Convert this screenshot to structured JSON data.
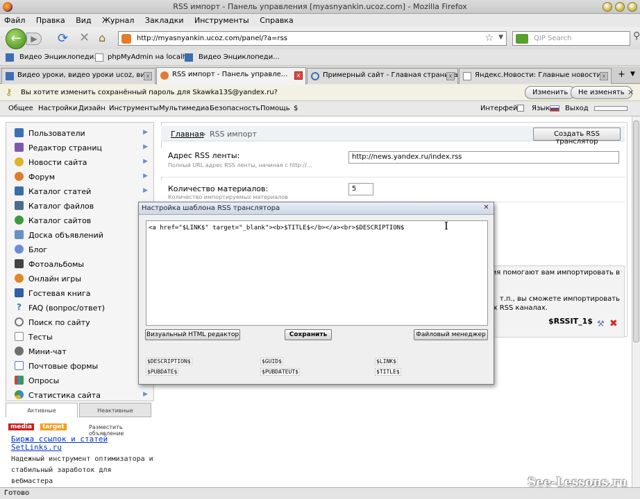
{
  "window": {
    "title": "RSS импорт - Панель управления [myasnyankin.ucoz.com] - Mozilla Firefox"
  },
  "menu": [
    "Файл",
    "Правка",
    "Вид",
    "Журнал",
    "Закладки",
    "Инструменты",
    "Справка"
  ],
  "nav": {
    "url": "http://myasnyankin.ucoz.com/panel/?a=rss",
    "search_placeholder": "QIP Search"
  },
  "bookmarks": [
    "Видео Энциклопеди...",
    "phpMyAdmin на localh...",
    "Видео Энциклопеди..."
  ],
  "tabs": [
    {
      "label": "Видео уроки, видео уроки ucoz, ви..."
    },
    {
      "label": "RSS импорт - Панель управле..."
    },
    {
      "label": "Примерный сайт - Главная страница"
    },
    {
      "label": "Яндекс.Новости: Главные новости"
    }
  ],
  "password_bar": {
    "message": "Вы хотите изменить сохранённый пароль для Skawka13S@yandex.ru?",
    "change": "Изменить",
    "dont_change": "Не изменять"
  },
  "app_toolbar": {
    "menu": [
      "Общее",
      "Настройки",
      "Дизайн",
      "Инструменты",
      "Мультимедиа",
      "Безопасность",
      "Помощь",
      "$"
    ],
    "interface": "Интерфейс",
    "language": "Язык",
    "logout": "Выход"
  },
  "sidebar": {
    "items": [
      {
        "label": "Пользователи",
        "arrow": true,
        "color": "#3b6fb6"
      },
      {
        "label": "Редактор страниц",
        "arrow": true,
        "color": "#7a5ba8"
      },
      {
        "label": "Новости сайта",
        "arrow": true,
        "color": "#e2b12a"
      },
      {
        "label": "Форум",
        "arrow": true,
        "color": "#e07b2a"
      },
      {
        "label": "Каталог статей",
        "arrow": true,
        "color": "#3a6ea5"
      },
      {
        "label": "Каталог файлов",
        "arrow": false,
        "color": "#4d6b8a"
      },
      {
        "label": "Каталог сайтов",
        "arrow": false,
        "color": "#3d9a3d"
      },
      {
        "label": "Доска объявлений",
        "arrow": false,
        "color": "#6b8fc4"
      },
      {
        "label": "Блог",
        "arrow": false,
        "color": "#6a8ed6"
      },
      {
        "label": "Фотоальбомы",
        "arrow": false,
        "color": "#444444"
      },
      {
        "label": "Онлайн игры",
        "arrow": false,
        "color": "#e0862a"
      },
      {
        "label": "Гостевая книга",
        "arrow": false,
        "color": "#2f5fa8"
      },
      {
        "label": "FAQ (вопрос/ответ)",
        "arrow": false,
        "color": "#3c6ec0"
      },
      {
        "label": "Поиск по сайту",
        "arrow": false,
        "color": "#777777"
      },
      {
        "label": "Тесты",
        "arrow": false,
        "color": "#8a8a8a"
      },
      {
        "label": "Мини-чат",
        "arrow": false,
        "color": "#6f6f6f"
      },
      {
        "label": "Почтовые формы",
        "arrow": false,
        "color": "#5a7bb0"
      },
      {
        "label": "Опросы",
        "arrow": false,
        "color": "#c44a2a"
      },
      {
        "label": "Статистика сайта",
        "arrow": true,
        "color": "#2f8fd0"
      }
    ],
    "tab_active": "Активные",
    "tab_inactive": "Неактивные"
  },
  "ad": {
    "brand1": "media",
    "brand2": "target",
    "place": "Разместить объявление",
    "title": "Биржа ссылок и статей SetLinks.ru",
    "text": "Надежный инструмент оптимизатора и стабильный заработок для вебмастера"
  },
  "main": {
    "breadcrumb_home": "Главная",
    "breadcrumb_sep": "»",
    "breadcrumb_current": "RSS импорт",
    "create_button": "Создать RSS транслятор",
    "field_address_label": "Адрес RSS ленты:",
    "field_address_hint": "Полный URL адрес RSS ленты, начиная с http://...",
    "field_address_value": "http://news.yandex.ru/index.rss",
    "field_count_label": "Количество материалов:",
    "field_count_hint": "Количество импортируемых материалов",
    "field_count_value": "5",
    "desc_line1": "ция помогают вам импортировать в",
    "desc_line2": "т.п., вы сможете импортировать",
    "desc_line3": "их RSS каналах.",
    "rss_var": "$RSSIT_1$"
  },
  "dialog": {
    "title": "Настройка шаблона RSS транслятора",
    "content": "<a href=\"$LINK$\" target=\"_blank\"><b>$TITLE$</b></a><br>$DESCRIPTION$",
    "btn_visual": "Визуальный HTML редактор",
    "btn_save": "Сохранить",
    "btn_files": "Файловый менеджер",
    "vars": [
      "$DESCRIPTION$",
      "$PUBDATE$",
      "$GUID$",
      "$PUBDATEUT$",
      "$LINK$",
      "$TITLE$"
    ]
  },
  "status": {
    "text": "Готово"
  },
  "watermark": "See-Lessons.ru"
}
